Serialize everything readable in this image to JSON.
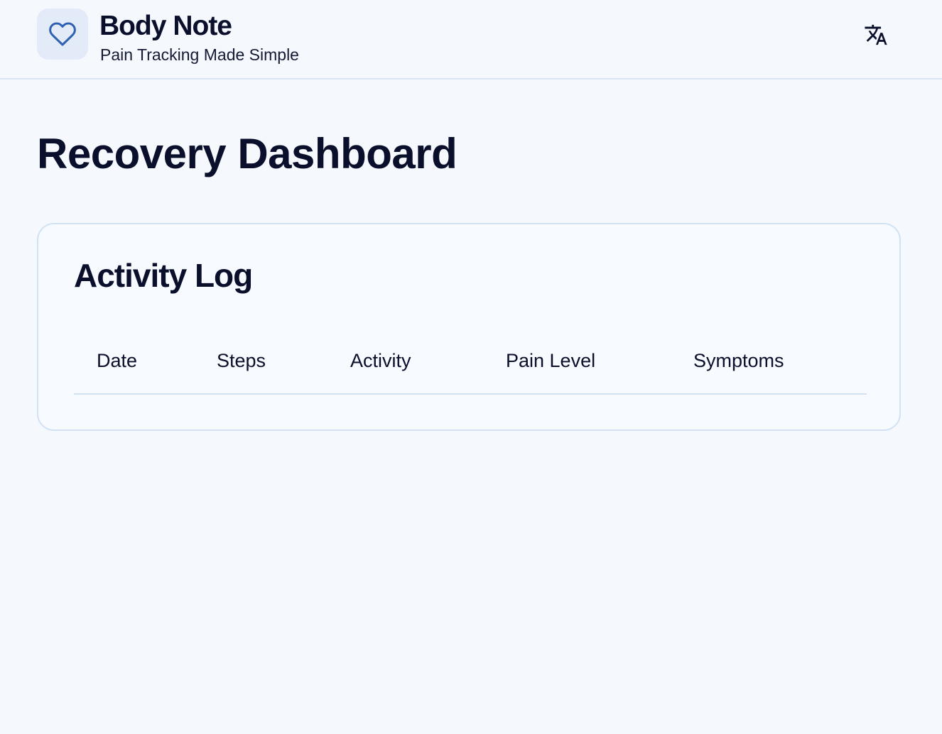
{
  "header": {
    "title": "Body Note",
    "subtitle": "Pain Tracking Made Simple",
    "logo_icon": "heart-icon",
    "language_icon": "translate-icon",
    "accent_color": "#2f62b3"
  },
  "main": {
    "page_title": "Recovery Dashboard",
    "activity_log": {
      "title": "Activity Log",
      "columns": [
        "Date",
        "Steps",
        "Activity",
        "Pain Level",
        "Symptoms"
      ],
      "rows": []
    }
  }
}
